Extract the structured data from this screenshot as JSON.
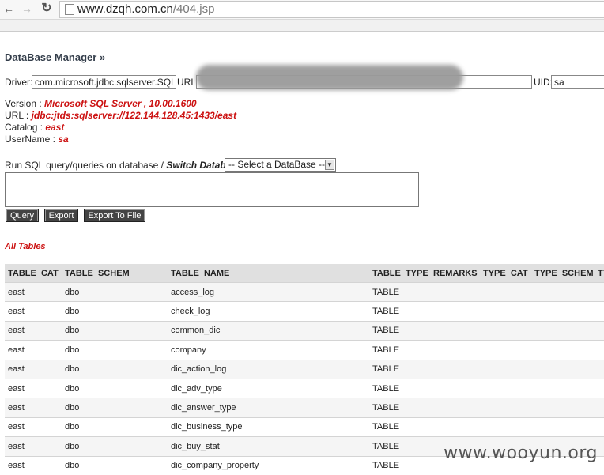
{
  "browser": {
    "url_domain": "www.dzqh.com.cn",
    "url_path": "/404.jsp"
  },
  "page": {
    "title": "DataBase Manager »"
  },
  "connection": {
    "driver_label": "Driver:",
    "driver_value": "com.microsoft.jdbc.sqlserver.SQLSer",
    "url_label": "URL:",
    "uid_label": "UID:",
    "uid_value": "sa"
  },
  "info": {
    "version_label": "Version :",
    "version_value": "Microsoft SQL Server , 10.00.1600",
    "url_label": "URL :",
    "url_value": "jdbc:jtds:sqlserver://122.144.128.45:1433/east",
    "catalog_label": "Catalog :",
    "catalog_value": "east",
    "username_label": "UserName :",
    "username_value": "sa"
  },
  "query": {
    "run_label": "Run SQL query/queries on database /",
    "switch_label": "Switch Database :",
    "select_value": "-- Select a DataBase --"
  },
  "buttons": {
    "query": "Query",
    "export": "Export",
    "export_file": "Export To File"
  },
  "tables_section": {
    "label": "All Tables",
    "headers": [
      "TABLE_CAT",
      "TABLE_SCHEM",
      "TABLE_NAME",
      "TABLE_TYPE",
      "REMARKS",
      "TYPE_CAT",
      "TYPE_SCHEM",
      "TY"
    ],
    "rows": [
      [
        "east",
        "dbo",
        "access_log",
        "TABLE"
      ],
      [
        "east",
        "dbo",
        "check_log",
        "TABLE"
      ],
      [
        "east",
        "dbo",
        "common_dic",
        "TABLE"
      ],
      [
        "east",
        "dbo",
        "company",
        "TABLE"
      ],
      [
        "east",
        "dbo",
        "dic_action_log",
        "TABLE"
      ],
      [
        "east",
        "dbo",
        "dic_adv_type",
        "TABLE"
      ],
      [
        "east",
        "dbo",
        "dic_answer_type",
        "TABLE"
      ],
      [
        "east",
        "dbo",
        "dic_business_type",
        "TABLE"
      ],
      [
        "east",
        "dbo",
        "dic_buy_stat",
        "TABLE"
      ],
      [
        "east",
        "dbo",
        "dic_company_property",
        "TABLE"
      ]
    ]
  },
  "watermark": "www.wooyun.org"
}
